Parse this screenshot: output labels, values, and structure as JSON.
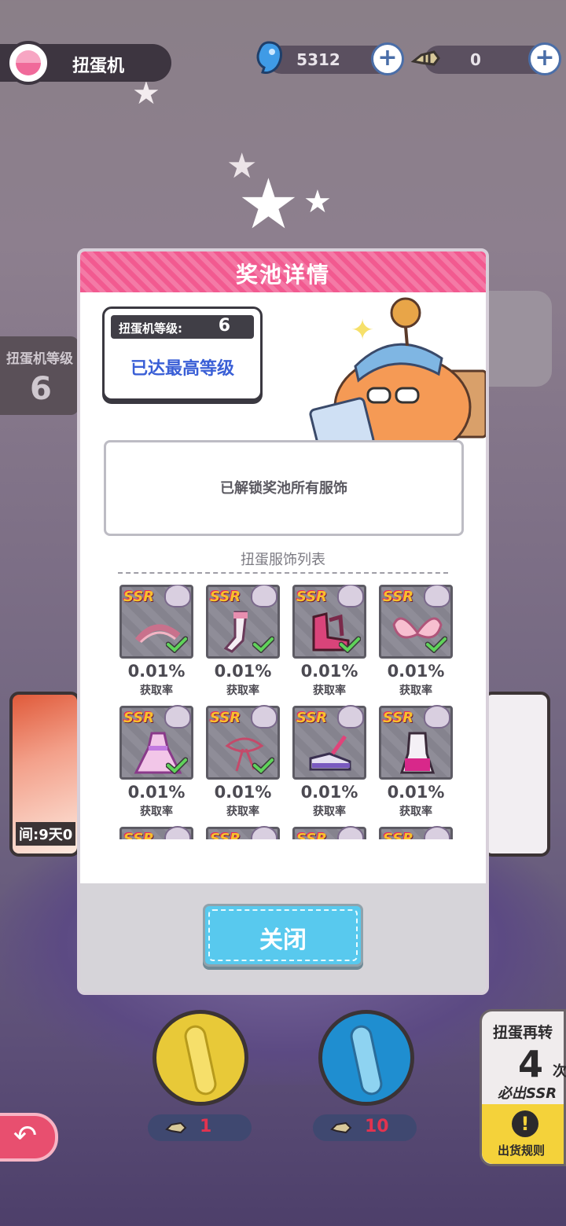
{
  "header": {
    "title": "扭蛋机",
    "currency_blue": "5312",
    "currency_fish": "0"
  },
  "side_level": {
    "label": "扭蛋机等级",
    "value": "6"
  },
  "left_card": {
    "time_text": "间:9天0"
  },
  "modal": {
    "title": "奖池详情",
    "level_label": "扭蛋机等级:",
    "level_value": "6",
    "level_max_text": "已达最高等级",
    "info_text": "已解锁奖池所有服饰",
    "list_title": "扭蛋服饰列表",
    "items": [
      {
        "rarity": "SSR",
        "rate": "0.01%",
        "rate_label": "获取率",
        "owned": true,
        "item_icon": "hair-ribbon-icon"
      },
      {
        "rarity": "SSR",
        "rate": "0.01%",
        "rate_label": "获取率",
        "owned": true,
        "item_icon": "stocking-icon"
      },
      {
        "rarity": "SSR",
        "rate": "0.01%",
        "rate_label": "获取率",
        "owned": true,
        "item_icon": "boots-icon"
      },
      {
        "rarity": "SSR",
        "rate": "0.01%",
        "rate_label": "获取率",
        "owned": true,
        "item_icon": "wings-icon"
      },
      {
        "rarity": "SSR",
        "rate": "0.01%",
        "rate_label": "获取率",
        "owned": true,
        "item_icon": "dress-icon"
      },
      {
        "rarity": "SSR",
        "rate": "0.01%",
        "rate_label": "获取率",
        "owned": true,
        "item_icon": "ribbon-icon"
      },
      {
        "rarity": "SSR",
        "rate": "0.01%",
        "rate_label": "获取率",
        "owned": false,
        "item_icon": "shoes-icon"
      },
      {
        "rarity": "SSR",
        "rate": "0.01%",
        "rate_label": "获取率",
        "owned": false,
        "item_icon": "outfit-icon"
      },
      {
        "rarity": "SSR",
        "rate": "",
        "rate_label": "",
        "owned": false,
        "item_icon": "partial-card"
      },
      {
        "rarity": "SSR",
        "rate": "",
        "rate_label": "",
        "owned": false,
        "item_icon": "partial-card"
      },
      {
        "rarity": "SSR",
        "rate": "",
        "rate_label": "",
        "owned": false,
        "item_icon": "partial-card"
      },
      {
        "rarity": "SSR",
        "rate": "",
        "rate_label": "",
        "owned": false,
        "item_icon": "partial-card"
      }
    ],
    "close_label": "关闭"
  },
  "gacha_buttons": {
    "single_cost": "1",
    "ten_cost": "10"
  },
  "gacha_note": {
    "line1": "扭蛋再转",
    "count": "4",
    "unit": "次",
    "line3": "必出SSR",
    "rules_label": "出货规则"
  },
  "colors": {
    "header_pink": "#f25a90",
    "close_blue": "#58c9ee",
    "level_blue": "#3a5fd6",
    "coin_yellow": "#e8c938",
    "coin_blue": "#1f8ed0",
    "ssr_gold": "#f8c02c",
    "check_green": "#5fd35a"
  }
}
